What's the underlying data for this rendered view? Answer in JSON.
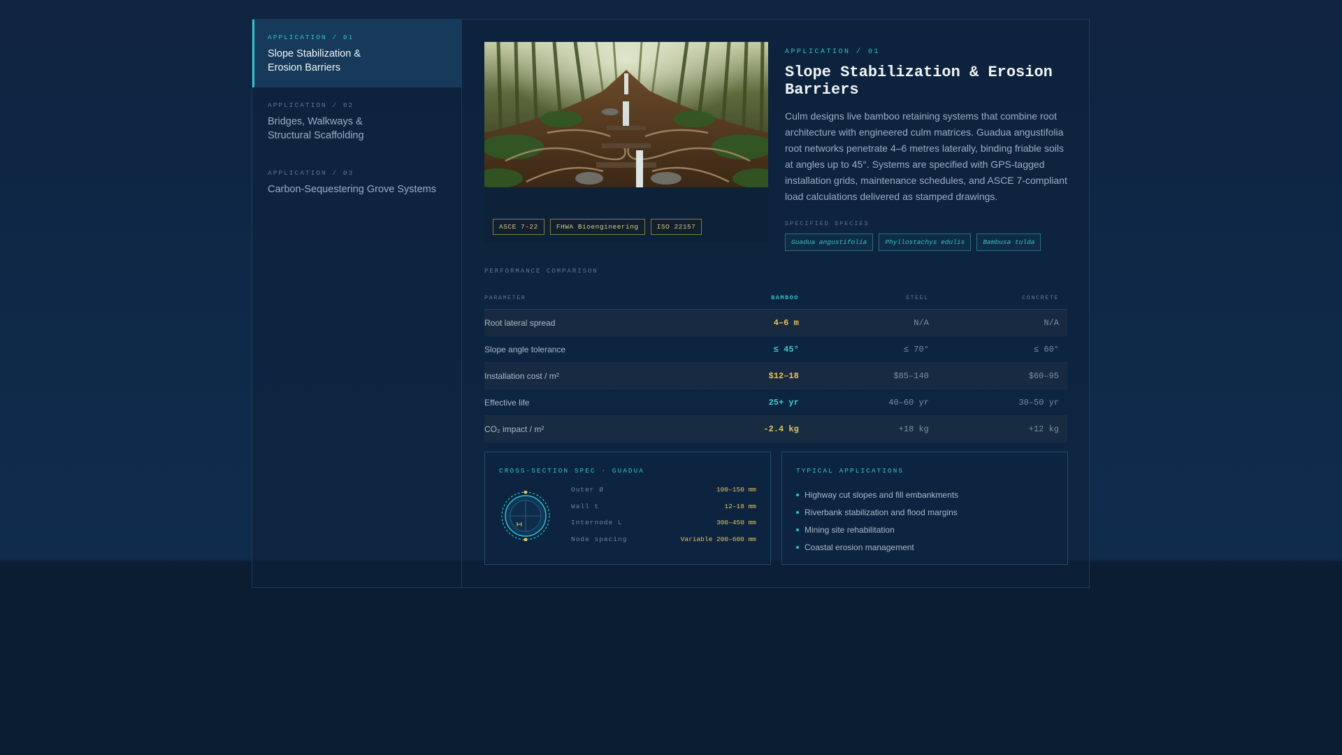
{
  "sidebar": {
    "items": [
      {
        "label": "APPLICATION / 01",
        "title_lines": [
          "Slope Stabilization &",
          "Erosion Barriers"
        ],
        "active": true
      },
      {
        "label": "APPLICATION / 02",
        "title_lines": [
          "Bridges, Walkways &",
          "Structural Scaffolding"
        ],
        "active": false
      },
      {
        "label": "APPLICATION / 03",
        "title_lines": [
          "Carbon-Sequestering Grove Systems"
        ],
        "active": false
      }
    ]
  },
  "hero": {
    "image_description_icon": "forest-slope-waterfall-image",
    "standards": [
      "ASCE 7-22",
      "FHWA Bioengineering",
      "ISO 22157"
    ]
  },
  "detail": {
    "kicker": "APPLICATION / 01",
    "title": "Slope Stabilization & Erosion Barriers",
    "description": "Culm designs live bamboo retaining systems that combine root architecture with engineered culm matrices. Guadua angustifolia root networks penetrate 4–6 metres laterally, binding friable soils at angles up to 45°. Systems are specified with GPS-tagged installation grids, maintenance schedules, and ASCE 7-compliant load calculations delivered as stamped drawings.",
    "species_label": "SPECIFIED SPECIES",
    "species": [
      "Guadua angustifolia",
      "Phyllostachys edulis",
      "Bambusa tulda"
    ]
  },
  "performance": {
    "label": "PERFORMANCE COMPARISON",
    "headers": [
      "PARAMETER",
      "BAMBOO",
      "STEEL",
      "CONCRETE"
    ],
    "rows": [
      {
        "param": "Root lateral spread",
        "bamboo": "4–6 m",
        "steel": "N/A",
        "concrete": "N/A",
        "accent": "yellow"
      },
      {
        "param": "Slope angle tolerance",
        "bamboo": "≤ 45°",
        "steel": "≤ 70°",
        "concrete": "≤ 60°",
        "accent": "cyan"
      },
      {
        "param": "Installation cost / m²",
        "bamboo": "$12–18",
        "steel": "$85–140",
        "concrete": "$60–95",
        "accent": "yellow"
      },
      {
        "param": "Effective life",
        "bamboo": "25+ yr",
        "steel": "40–60 yr",
        "concrete": "30–50 yr",
        "accent": "cyan"
      },
      {
        "param": "CO₂ impact / m²",
        "bamboo": "-2.4 kg",
        "steel": "+18 kg",
        "concrete": "+12 kg",
        "accent": "yellow"
      }
    ]
  },
  "cross_section": {
    "title": "CROSS-SECTION SPEC · GUADUA",
    "icon": "culm-cross-section-icon",
    "specs": [
      {
        "key": "Outer Ø",
        "value": "100–150 mm"
      },
      {
        "key": "Wall t",
        "value": "12–18 mm"
      },
      {
        "key": "Internode L",
        "value": "300–450 mm"
      },
      {
        "key": "Node spacing",
        "value": "Variable 200–600 mm"
      }
    ]
  },
  "typical_apps": {
    "title": "TYPICAL APPLICATIONS",
    "items": [
      "Highway cut slopes and fill embankments",
      "Riverbank stabilization and flood margins",
      "Mining site rehabilitation",
      "Coastal erosion management"
    ]
  },
  "colors": {
    "accent_cyan": "#2fc2c9",
    "accent_yellow": "#e8c25a",
    "background": "#0f2a4a"
  }
}
